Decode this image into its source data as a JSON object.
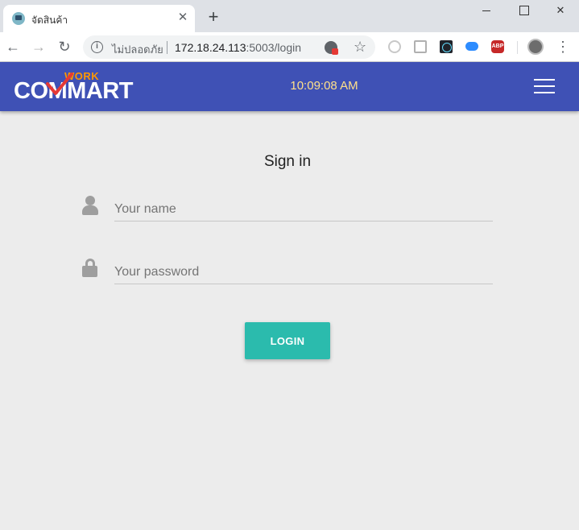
{
  "browser": {
    "tab_title": "จัดสินค้า",
    "tab_close": "✕",
    "new_tab": "+",
    "address": {
      "security_label": "ไม่ปลอดภัย",
      "host": "172.18.24.113",
      "path": ":5003/login"
    },
    "icons": {
      "back": "back-arrow-icon",
      "forward": "forward-arrow-icon",
      "reload": "reload-icon",
      "info": "info-icon",
      "bookmark": "star-icon",
      "menu": "more-vert-icon"
    },
    "extensions": [
      "ext-circle-icon",
      "ext-trello-icon",
      "react-devtools-icon",
      "cloud-icon",
      "adblock-plus-icon"
    ],
    "adblock_label": "ABP"
  },
  "header": {
    "logo_work": "WORK",
    "logo_main": "COMMART",
    "clock": "10:09:08 AM",
    "accent": "#3f51b5",
    "clock_color": "#ffe08a"
  },
  "login": {
    "title": "Sign in",
    "name_placeholder": "Your name",
    "name_value": "",
    "password_placeholder": "Your password",
    "password_value": "",
    "button_label": "LOGIN",
    "button_color": "#2bbbad"
  }
}
